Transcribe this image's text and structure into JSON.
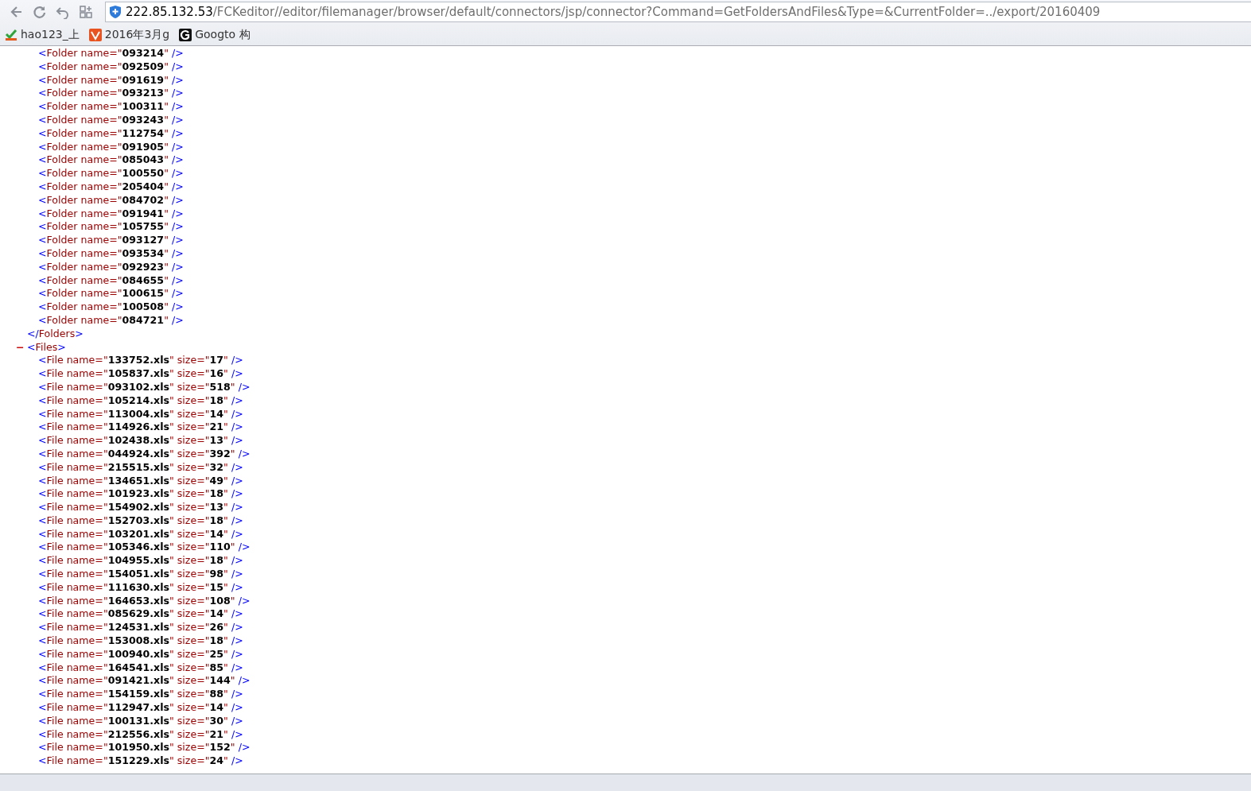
{
  "browser": {
    "address": {
      "host": "222.85.132.53",
      "path": "/FCKeditor//editor/filemanager/browser/default/connectors/jsp/connector?Command=GetFoldersAndFiles&Type=&CurrentFolder=../export/20160409"
    },
    "bookmarks": [
      {
        "label": "hao123_上",
        "kind": "hao"
      },
      {
        "label": "2016年3月g",
        "kind": "shield"
      },
      {
        "label": "Googto 构",
        "kind": "g"
      }
    ]
  },
  "xml": {
    "nodes": [
      {
        "children": [
          {
            "line": "<Folder name=\"**093214**\" />"
          },
          {
            "line": "<Folder name=\"**092509**\" />"
          },
          {
            "line": "<Folder name=\"**091619**\" />"
          },
          {
            "line": "<Folder name=\"**093213**\" />"
          },
          {
            "line": "<Folder name=\"**100311**\" />"
          },
          {
            "line": "<Folder name=\"**093243**\" />"
          },
          {
            "line": "<Folder name=\"**112754**\" />"
          },
          {
            "line": "<Folder name=\"**091905**\" />"
          },
          {
            "line": "<Folder name=\"**085043**\" />"
          },
          {
            "line": "<Folder name=\"**100550**\" />"
          },
          {
            "line": "<Folder name=\"**205404**\" />"
          },
          {
            "line": "<Folder name=\"**084702**\" />"
          },
          {
            "line": "<Folder name=\"**091941**\" />"
          },
          {
            "line": "<Folder name=\"**105755**\" />"
          },
          {
            "line": "<Folder name=\"**093127**\" />"
          },
          {
            "line": "<Folder name=\"**093534**\" />"
          },
          {
            "line": "<Folder name=\"**092923**\" />"
          },
          {
            "line": "<Folder name=\"**084655**\" />"
          },
          {
            "line": "<Folder name=\"**100615**\" />"
          },
          {
            "line": "<Folder name=\"**100508**\" />"
          },
          {
            "line": "<Folder name=\"**084721**\" />"
          }
        ],
        "close": "</Folders>"
      },
      {
        "toggle": "−",
        "line": "<Files>",
        "children": [
          {
            "line": "<File name=\"**133752.xls**\" size=\"**17**\" />"
          },
          {
            "line": "<File name=\"**105837.xls**\" size=\"**16**\" />"
          },
          {
            "line": "<File name=\"**093102.xls**\" size=\"**518**\" />"
          },
          {
            "line": "<File name=\"**105214.xls**\" size=\"**18**\" />"
          },
          {
            "line": "<File name=\"**113004.xls**\" size=\"**14**\" />"
          },
          {
            "line": "<File name=\"**114926.xls**\" size=\"**21**\" />"
          },
          {
            "line": "<File name=\"**102438.xls**\" size=\"**13**\" />"
          },
          {
            "line": "<File name=\"**044924.xls**\" size=\"**392**\" />"
          },
          {
            "line": "<File name=\"**215515.xls**\" size=\"**32**\" />"
          },
          {
            "line": "<File name=\"**134651.xls**\" size=\"**49**\" />"
          },
          {
            "line": "<File name=\"**101923.xls**\" size=\"**18**\" />"
          },
          {
            "line": "<File name=\"**154902.xls**\" size=\"**13**\" />"
          },
          {
            "line": "<File name=\"**152703.xls**\" size=\"**18**\" />"
          },
          {
            "line": "<File name=\"**103201.xls**\" size=\"**14**\" />"
          },
          {
            "line": "<File name=\"**105346.xls**\" size=\"**110**\" />"
          },
          {
            "line": "<File name=\"**104955.xls**\" size=\"**18**\" />"
          },
          {
            "line": "<File name=\"**154051.xls**\" size=\"**98**\" />"
          },
          {
            "line": "<File name=\"**111630.xls**\" size=\"**15**\" />"
          },
          {
            "line": "<File name=\"**164653.xls**\" size=\"**108**\" />"
          },
          {
            "line": "<File name=\"**085629.xls**\" size=\"**14**\" />"
          },
          {
            "line": "<File name=\"**124531.xls**\" size=\"**26**\" />"
          },
          {
            "line": "<File name=\"**153008.xls**\" size=\"**18**\" />"
          },
          {
            "line": "<File name=\"**100940.xls**\" size=\"**25**\" />"
          },
          {
            "line": "<File name=\"**164541.xls**\" size=\"**85**\" />"
          },
          {
            "line": "<File name=\"**091421.xls**\" size=\"**144**\" />"
          },
          {
            "line": "<File name=\"**154159.xls**\" size=\"**88**\" />"
          },
          {
            "line": "<File name=\"**112947.xls**\" size=\"**14**\" />"
          },
          {
            "line": "<File name=\"**100131.xls**\" size=\"**30**\" />"
          },
          {
            "line": "<File name=\"**212556.xls**\" size=\"**21**\" />"
          },
          {
            "line": "<File name=\"**101950.xls**\" size=\"**152**\" />"
          },
          {
            "line": "<File name=\"**151229.xls**\" size=\"**24**\" />"
          }
        ]
      }
    ]
  }
}
